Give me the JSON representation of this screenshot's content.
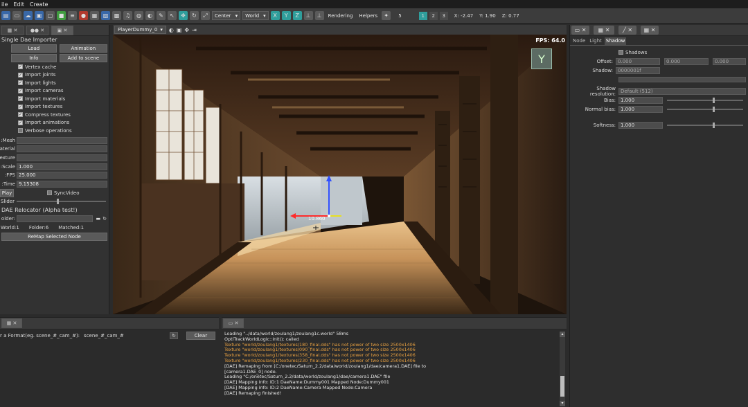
{
  "menubar": {
    "items": [
      "ile",
      "Edit",
      "Create"
    ]
  },
  "toolbar": {
    "pivot": "Center",
    "space": "World",
    "axes": [
      "X",
      "Y",
      "Z"
    ],
    "rendering": "Rendering",
    "helpers": "Helpers",
    "speed": "5",
    "layers": [
      "1",
      "2",
      "3"
    ],
    "coords": {
      "x": "X: -2.47",
      "y": "Y: 1.90",
      "z": "Z: 0.77"
    }
  },
  "left": {
    "title": "Single Dae Importer",
    "load": "Load",
    "animation": "Animation",
    "info": "Info",
    "add_to_scene": "Add to scene",
    "checks": [
      {
        "label": "Vertex cache",
        "on": true
      },
      {
        "label": "Import joints",
        "on": true
      },
      {
        "label": "Import lights",
        "on": true
      },
      {
        "label": "Import cameras",
        "on": true
      },
      {
        "label": "Import materials",
        "on": true
      },
      {
        "label": "Import textures",
        "on": true
      },
      {
        "label": "Compress textures",
        "on": true
      },
      {
        "label": "Import animations",
        "on": true
      },
      {
        "label": "Verbose operations",
        "on": false
      }
    ],
    "fields": [
      {
        "label": "Mesh:",
        "value": ""
      },
      {
        "label": "aterial:",
        "value": ""
      },
      {
        "label": "exture:",
        "value": ""
      },
      {
        "label": "Scale:",
        "value": "1.000"
      },
      {
        "label": "FPS:",
        "value": "25.000"
      },
      {
        "label": "Time:",
        "value": "9.15308"
      }
    ],
    "play": "Play",
    "syncvideo": "SyncVideo",
    "slider": "Slider",
    "relocator_title": "DAE Relocator (Alpha test!)",
    "folder_label": "older:",
    "stats": {
      "world": "World:1",
      "folder": "Folder:6",
      "matched": "Matched:1"
    },
    "remap": "ReMap Selected Node"
  },
  "viewport": {
    "camera": "PlayerDummy_0",
    "fps": "FPS: 64.0",
    "axis_gizmo": "Y",
    "distance": "10.860"
  },
  "right": {
    "subtabs": [
      "Node",
      "Light",
      "Shadow"
    ],
    "active_subtab": "Shadow",
    "shadows_label": "Shadows",
    "offset_label": "Offset:",
    "offset": [
      "0.000",
      "0.000",
      "0.000"
    ],
    "shadow_label": "Shadow:",
    "shadow_mask": "0000001f",
    "resolution_label": "Shadow resolution:",
    "resolution": "Default (512)",
    "bias_label": "Bias:",
    "bias": "1.000",
    "normal_bias_label": "Normal bias:",
    "normal_bias": "1.000",
    "softness_label": "Softness:",
    "softness": "1.000"
  },
  "bottom_left": {
    "prompt": "r a Format(eg. scene_#_cam_#):",
    "value": "scene_#_cam_#",
    "clear": "Clear"
  },
  "console": {
    "lines": [
      {
        "text": "Loading \"../data/world/zoulang1/zoulang1c.world\" 58ms",
        "kind": "n"
      },
      {
        "text": "OptiTrackWorldLogic::init(): called",
        "kind": "n"
      },
      {
        "text": "Texture \"world/zoulang1/textures/180_final.dds\" has not power of two size 2500x1406",
        "kind": "w"
      },
      {
        "text": "Texture \"world/zoulang1/textures/090_final.dds\" has not power of two size 2500x1406",
        "kind": "w"
      },
      {
        "text": "Texture \"world/zoulang1/textures/358_final.dds\" has not power of two size 2500x1406",
        "kind": "w"
      },
      {
        "text": "Texture \"world/zoulang1/textures/230_final.dds\" has not power of two size 2500x1406",
        "kind": "w"
      },
      {
        "text": "[DAE] Remaping from [C:/onetec/Saturn_2.2/data/world/zoulang1/dae/camera1.DAE] file to",
        "kind": "n"
      },
      {
        "text": "[camera1.DAE_0] node.",
        "kind": "n"
      },
      {
        "text": "Loading \"C:/onetec/Saturn_2.2/data/world/zoulang1/dae/camera1.DAE\" file",
        "kind": "n"
      },
      {
        "text": "[DAE] Mapping info: ID:1 DaeName:Dummy001 Mapped Node:Dummy001",
        "kind": "n"
      },
      {
        "text": "[DAE] Mapping info: ID:2 DaeName:Camera Mapped Node:Camera",
        "kind": "n"
      },
      {
        "text": "[DAE] Remaping finished!",
        "kind": "n"
      }
    ]
  }
}
